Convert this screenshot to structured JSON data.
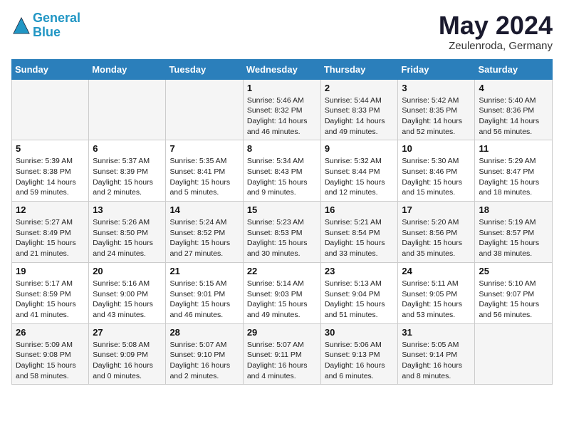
{
  "header": {
    "logo_line1": "General",
    "logo_line2": "Blue",
    "month": "May 2024",
    "location": "Zeulenroda, Germany"
  },
  "days_of_week": [
    "Sunday",
    "Monday",
    "Tuesday",
    "Wednesday",
    "Thursday",
    "Friday",
    "Saturday"
  ],
  "weeks": [
    [
      {
        "day": "",
        "sunrise": "",
        "sunset": "",
        "daylight": ""
      },
      {
        "day": "",
        "sunrise": "",
        "sunset": "",
        "daylight": ""
      },
      {
        "day": "",
        "sunrise": "",
        "sunset": "",
        "daylight": ""
      },
      {
        "day": "1",
        "sunrise": "Sunrise: 5:46 AM",
        "sunset": "Sunset: 8:32 PM",
        "daylight": "Daylight: 14 hours and 46 minutes."
      },
      {
        "day": "2",
        "sunrise": "Sunrise: 5:44 AM",
        "sunset": "Sunset: 8:33 PM",
        "daylight": "Daylight: 14 hours and 49 minutes."
      },
      {
        "day": "3",
        "sunrise": "Sunrise: 5:42 AM",
        "sunset": "Sunset: 8:35 PM",
        "daylight": "Daylight: 14 hours and 52 minutes."
      },
      {
        "day": "4",
        "sunrise": "Sunrise: 5:40 AM",
        "sunset": "Sunset: 8:36 PM",
        "daylight": "Daylight: 14 hours and 56 minutes."
      }
    ],
    [
      {
        "day": "5",
        "sunrise": "Sunrise: 5:39 AM",
        "sunset": "Sunset: 8:38 PM",
        "daylight": "Daylight: 14 hours and 59 minutes."
      },
      {
        "day": "6",
        "sunrise": "Sunrise: 5:37 AM",
        "sunset": "Sunset: 8:39 PM",
        "daylight": "Daylight: 15 hours and 2 minutes."
      },
      {
        "day": "7",
        "sunrise": "Sunrise: 5:35 AM",
        "sunset": "Sunset: 8:41 PM",
        "daylight": "Daylight: 15 hours and 5 minutes."
      },
      {
        "day": "8",
        "sunrise": "Sunrise: 5:34 AM",
        "sunset": "Sunset: 8:43 PM",
        "daylight": "Daylight: 15 hours and 9 minutes."
      },
      {
        "day": "9",
        "sunrise": "Sunrise: 5:32 AM",
        "sunset": "Sunset: 8:44 PM",
        "daylight": "Daylight: 15 hours and 12 minutes."
      },
      {
        "day": "10",
        "sunrise": "Sunrise: 5:30 AM",
        "sunset": "Sunset: 8:46 PM",
        "daylight": "Daylight: 15 hours and 15 minutes."
      },
      {
        "day": "11",
        "sunrise": "Sunrise: 5:29 AM",
        "sunset": "Sunset: 8:47 PM",
        "daylight": "Daylight: 15 hours and 18 minutes."
      }
    ],
    [
      {
        "day": "12",
        "sunrise": "Sunrise: 5:27 AM",
        "sunset": "Sunset: 8:49 PM",
        "daylight": "Daylight: 15 hours and 21 minutes."
      },
      {
        "day": "13",
        "sunrise": "Sunrise: 5:26 AM",
        "sunset": "Sunset: 8:50 PM",
        "daylight": "Daylight: 15 hours and 24 minutes."
      },
      {
        "day": "14",
        "sunrise": "Sunrise: 5:24 AM",
        "sunset": "Sunset: 8:52 PM",
        "daylight": "Daylight: 15 hours and 27 minutes."
      },
      {
        "day": "15",
        "sunrise": "Sunrise: 5:23 AM",
        "sunset": "Sunset: 8:53 PM",
        "daylight": "Daylight: 15 hours and 30 minutes."
      },
      {
        "day": "16",
        "sunrise": "Sunrise: 5:21 AM",
        "sunset": "Sunset: 8:54 PM",
        "daylight": "Daylight: 15 hours and 33 minutes."
      },
      {
        "day": "17",
        "sunrise": "Sunrise: 5:20 AM",
        "sunset": "Sunset: 8:56 PM",
        "daylight": "Daylight: 15 hours and 35 minutes."
      },
      {
        "day": "18",
        "sunrise": "Sunrise: 5:19 AM",
        "sunset": "Sunset: 8:57 PM",
        "daylight": "Daylight: 15 hours and 38 minutes."
      }
    ],
    [
      {
        "day": "19",
        "sunrise": "Sunrise: 5:17 AM",
        "sunset": "Sunset: 8:59 PM",
        "daylight": "Daylight: 15 hours and 41 minutes."
      },
      {
        "day": "20",
        "sunrise": "Sunrise: 5:16 AM",
        "sunset": "Sunset: 9:00 PM",
        "daylight": "Daylight: 15 hours and 43 minutes."
      },
      {
        "day": "21",
        "sunrise": "Sunrise: 5:15 AM",
        "sunset": "Sunset: 9:01 PM",
        "daylight": "Daylight: 15 hours and 46 minutes."
      },
      {
        "day": "22",
        "sunrise": "Sunrise: 5:14 AM",
        "sunset": "Sunset: 9:03 PM",
        "daylight": "Daylight: 15 hours and 49 minutes."
      },
      {
        "day": "23",
        "sunrise": "Sunrise: 5:13 AM",
        "sunset": "Sunset: 9:04 PM",
        "daylight": "Daylight: 15 hours and 51 minutes."
      },
      {
        "day": "24",
        "sunrise": "Sunrise: 5:11 AM",
        "sunset": "Sunset: 9:05 PM",
        "daylight": "Daylight: 15 hours and 53 minutes."
      },
      {
        "day": "25",
        "sunrise": "Sunrise: 5:10 AM",
        "sunset": "Sunset: 9:07 PM",
        "daylight": "Daylight: 15 hours and 56 minutes."
      }
    ],
    [
      {
        "day": "26",
        "sunrise": "Sunrise: 5:09 AM",
        "sunset": "Sunset: 9:08 PM",
        "daylight": "Daylight: 15 hours and 58 minutes."
      },
      {
        "day": "27",
        "sunrise": "Sunrise: 5:08 AM",
        "sunset": "Sunset: 9:09 PM",
        "daylight": "Daylight: 16 hours and 0 minutes."
      },
      {
        "day": "28",
        "sunrise": "Sunrise: 5:07 AM",
        "sunset": "Sunset: 9:10 PM",
        "daylight": "Daylight: 16 hours and 2 minutes."
      },
      {
        "day": "29",
        "sunrise": "Sunrise: 5:07 AM",
        "sunset": "Sunset: 9:11 PM",
        "daylight": "Daylight: 16 hours and 4 minutes."
      },
      {
        "day": "30",
        "sunrise": "Sunrise: 5:06 AM",
        "sunset": "Sunset: 9:13 PM",
        "daylight": "Daylight: 16 hours and 6 minutes."
      },
      {
        "day": "31",
        "sunrise": "Sunrise: 5:05 AM",
        "sunset": "Sunset: 9:14 PM",
        "daylight": "Daylight: 16 hours and 8 minutes."
      },
      {
        "day": "",
        "sunrise": "",
        "sunset": "",
        "daylight": ""
      }
    ]
  ]
}
